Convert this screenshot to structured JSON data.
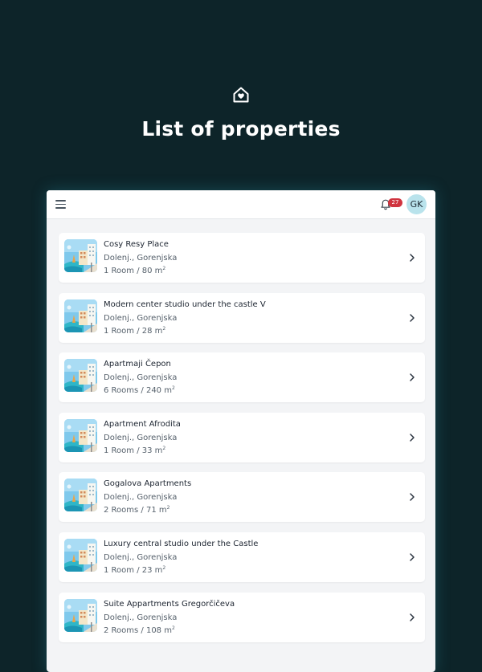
{
  "header": {
    "title": "List of properties",
    "icon": "home-heart-icon"
  },
  "topbar": {
    "menu_icon": "hamburger-menu-icon",
    "notifications_icon": "bell-icon",
    "notification_count": "27",
    "avatar_initials": "GK"
  },
  "colors": {
    "background": "#0d2429",
    "badge": "#d0343f",
    "avatar": "#b9e3ec"
  },
  "properties": [
    {
      "name": "Cosy Resy Place",
      "location": "Dolenj., Gorenjska",
      "size": "1 Room / 80 m",
      "unit_exp": "2"
    },
    {
      "name": "Modern center studio under the castle V",
      "location": "Dolenj., Gorenjska",
      "size": "1 Room / 28 m",
      "unit_exp": "2"
    },
    {
      "name": "Apartmaji Čepon",
      "location": "Dolenj., Gorenjska",
      "size": "6 Rooms / 240 m",
      "unit_exp": "2"
    },
    {
      "name": "Apartment Afrodita",
      "location": "Dolenj., Gorenjska",
      "size": "1 Room / 33 m",
      "unit_exp": "2"
    },
    {
      "name": "Gogalova Apartments",
      "location": "Dolenj., Gorenjska",
      "size": "2 Rooms / 71 m",
      "unit_exp": "2"
    },
    {
      "name": "Luxury central studio under the Castle",
      "location": "Dolenj., Gorenjska",
      "size": "1 Room / 23 m",
      "unit_exp": "2"
    },
    {
      "name": "Suite Appartments Gregorčičeva",
      "location": "Dolenj., Gorenjska",
      "size": "2 Rooms / 108 m",
      "unit_exp": "2"
    }
  ]
}
